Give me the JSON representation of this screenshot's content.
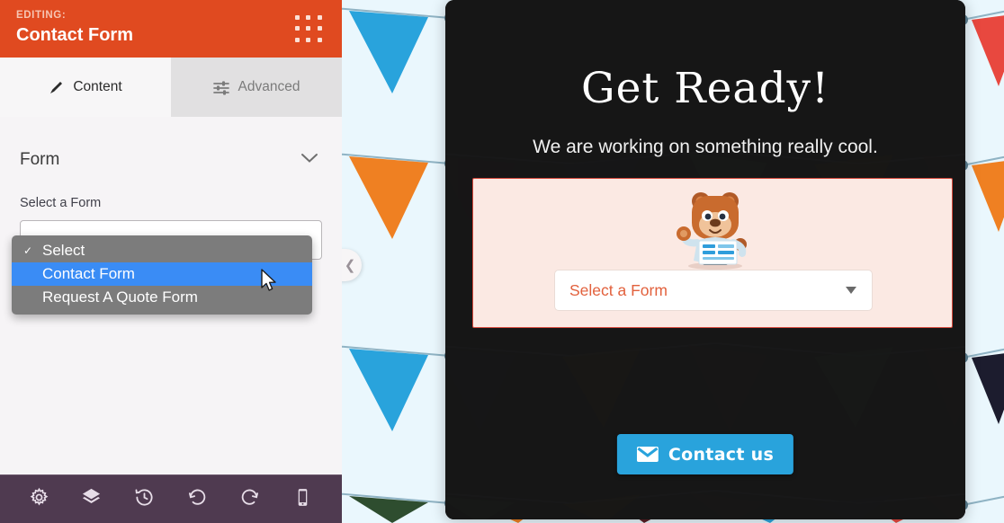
{
  "sidebar": {
    "header": {
      "eyebrow": "EDITING:",
      "title": "Contact Form",
      "handle_icon": "grid-dots-icon"
    },
    "tabs": [
      {
        "label": "Content",
        "icon": "pencil-icon",
        "active": true
      },
      {
        "label": "Advanced",
        "icon": "sliders-icon",
        "active": false
      }
    ],
    "section": {
      "title": "Form",
      "toggle_icon": "chevron-down-icon"
    },
    "field": {
      "label": "Select a Form",
      "value": "Select",
      "options": [
        {
          "label": "Select",
          "selected": true,
          "highlighted": false
        },
        {
          "label": "Contact Form",
          "selected": false,
          "highlighted": true
        },
        {
          "label": "Request A Quote Form",
          "selected": false,
          "highlighted": false
        }
      ]
    },
    "footer_icons": [
      "gear-icon",
      "layers-icon",
      "history-icon",
      "undo-icon",
      "redo-icon",
      "mobile-icon"
    ]
  },
  "preview": {
    "collapse_handle_icon": "chevron-left-icon",
    "heading": "Get Ready!",
    "subheading": "We are working on something really cool.",
    "form_card": {
      "mascot": "bear-mascot-icon",
      "select_placeholder": "Select a Form",
      "select_caret_icon": "caret-down-icon"
    },
    "contact_button": {
      "label": "Contact us",
      "icon": "envelope-icon"
    }
  },
  "colors": {
    "header_orange": "#e04a20",
    "accent_blue": "#29a3dc",
    "dropdown_highlight": "#3a8cf5",
    "dropdown_bg": "#7c7c7c",
    "footer_purple": "#4f3a50",
    "card_pink": "#fbe9e3",
    "card_border_red": "#d4483b",
    "form_text_orange": "#e2613d",
    "preview_bg": "#eaf7fd"
  }
}
